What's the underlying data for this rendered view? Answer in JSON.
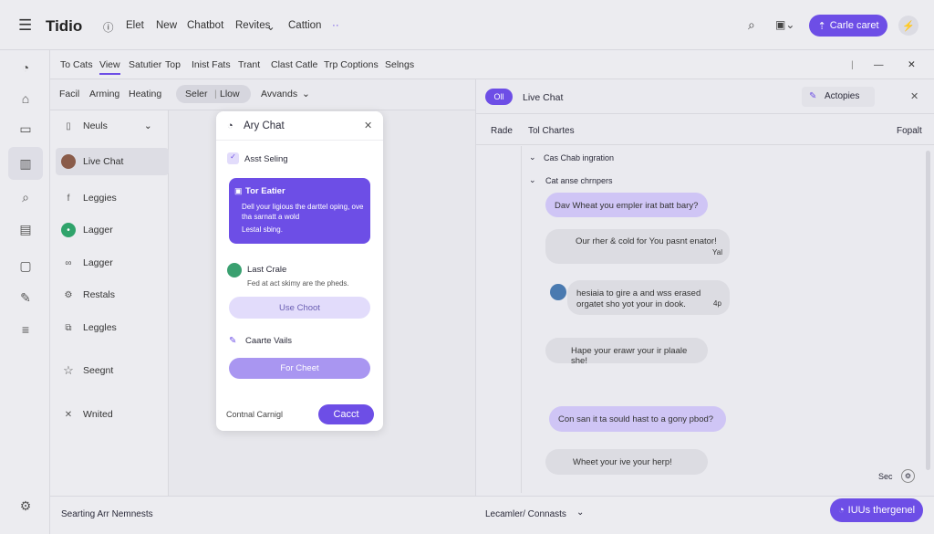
{
  "topbar": {
    "brand": "Tidio",
    "nav": [
      "Elet",
      "New",
      "Chatbot",
      "Revites",
      "Cattion",
      "··"
    ],
    "cta": "Carle caret"
  },
  "subnav": [
    "To Cats",
    "View",
    "Satutier",
    "Top",
    "Inist Fats",
    "Trant",
    "Clast Catle",
    "Trp Coptions",
    "Selngs"
  ],
  "filters": {
    "a": "Facil",
    "b": "Arming",
    "c": "Heating",
    "d": "Seler",
    "e": "Llow",
    "f": "Avvands"
  },
  "leftlist": {
    "header": "Neuls",
    "items": [
      {
        "label": "Live Chat"
      },
      {
        "label": "Leggies"
      },
      {
        "label": "Lagger"
      },
      {
        "label": "Lagger"
      },
      {
        "label": "Restals"
      },
      {
        "label": "Leggles"
      },
      {
        "label": "Seegnt"
      },
      {
        "label": "Wnited"
      }
    ]
  },
  "modal": {
    "title": "Ary Chat",
    "section1": "Asst Seling",
    "card_title": "Tor Eatier",
    "card_text": "Dell your ligious the darttel oping, ove tha sarnatt a wold",
    "card_sub": "Lestal sbing.",
    "section2": "Last Crale",
    "section2_text": "Fed at act skimy are the pheds.",
    "btn1": "Use Choot",
    "section3": "Caarte Vails",
    "btn2": "For Cheet",
    "footer_link": "Contnal Carnigl",
    "footer_btn": "Cacct"
  },
  "right": {
    "badge": "Oll",
    "title": "Live Chat",
    "action": "Actopies",
    "col1": "Rade",
    "col2": "Tol Chartes",
    "col3": "Fopalt",
    "row1": "Cas Chab ingration",
    "row2": "Cat anse chrnpers",
    "messages": [
      {
        "text": "Dav Wheat you empler irat batt bary?"
      },
      {
        "text": "Our rher & cold for You pasnt enator!",
        "meta": "Yal"
      },
      {
        "text": "hesiaia to gire a and wss erased orgatet sho yot your in dook.",
        "meta": "4p"
      },
      {
        "text": "Hape your erawr your ir plaale she!"
      },
      {
        "text": "Con san it ta sould hast to a gony pbod?"
      },
      {
        "text": "Wheet your ive your herp!"
      }
    ],
    "sec": "Sec"
  },
  "bottom": {
    "left": "Searting Arr Nemnests",
    "mid": "Lecamler/ Connasts",
    "btn": "IUUs thergenel"
  }
}
